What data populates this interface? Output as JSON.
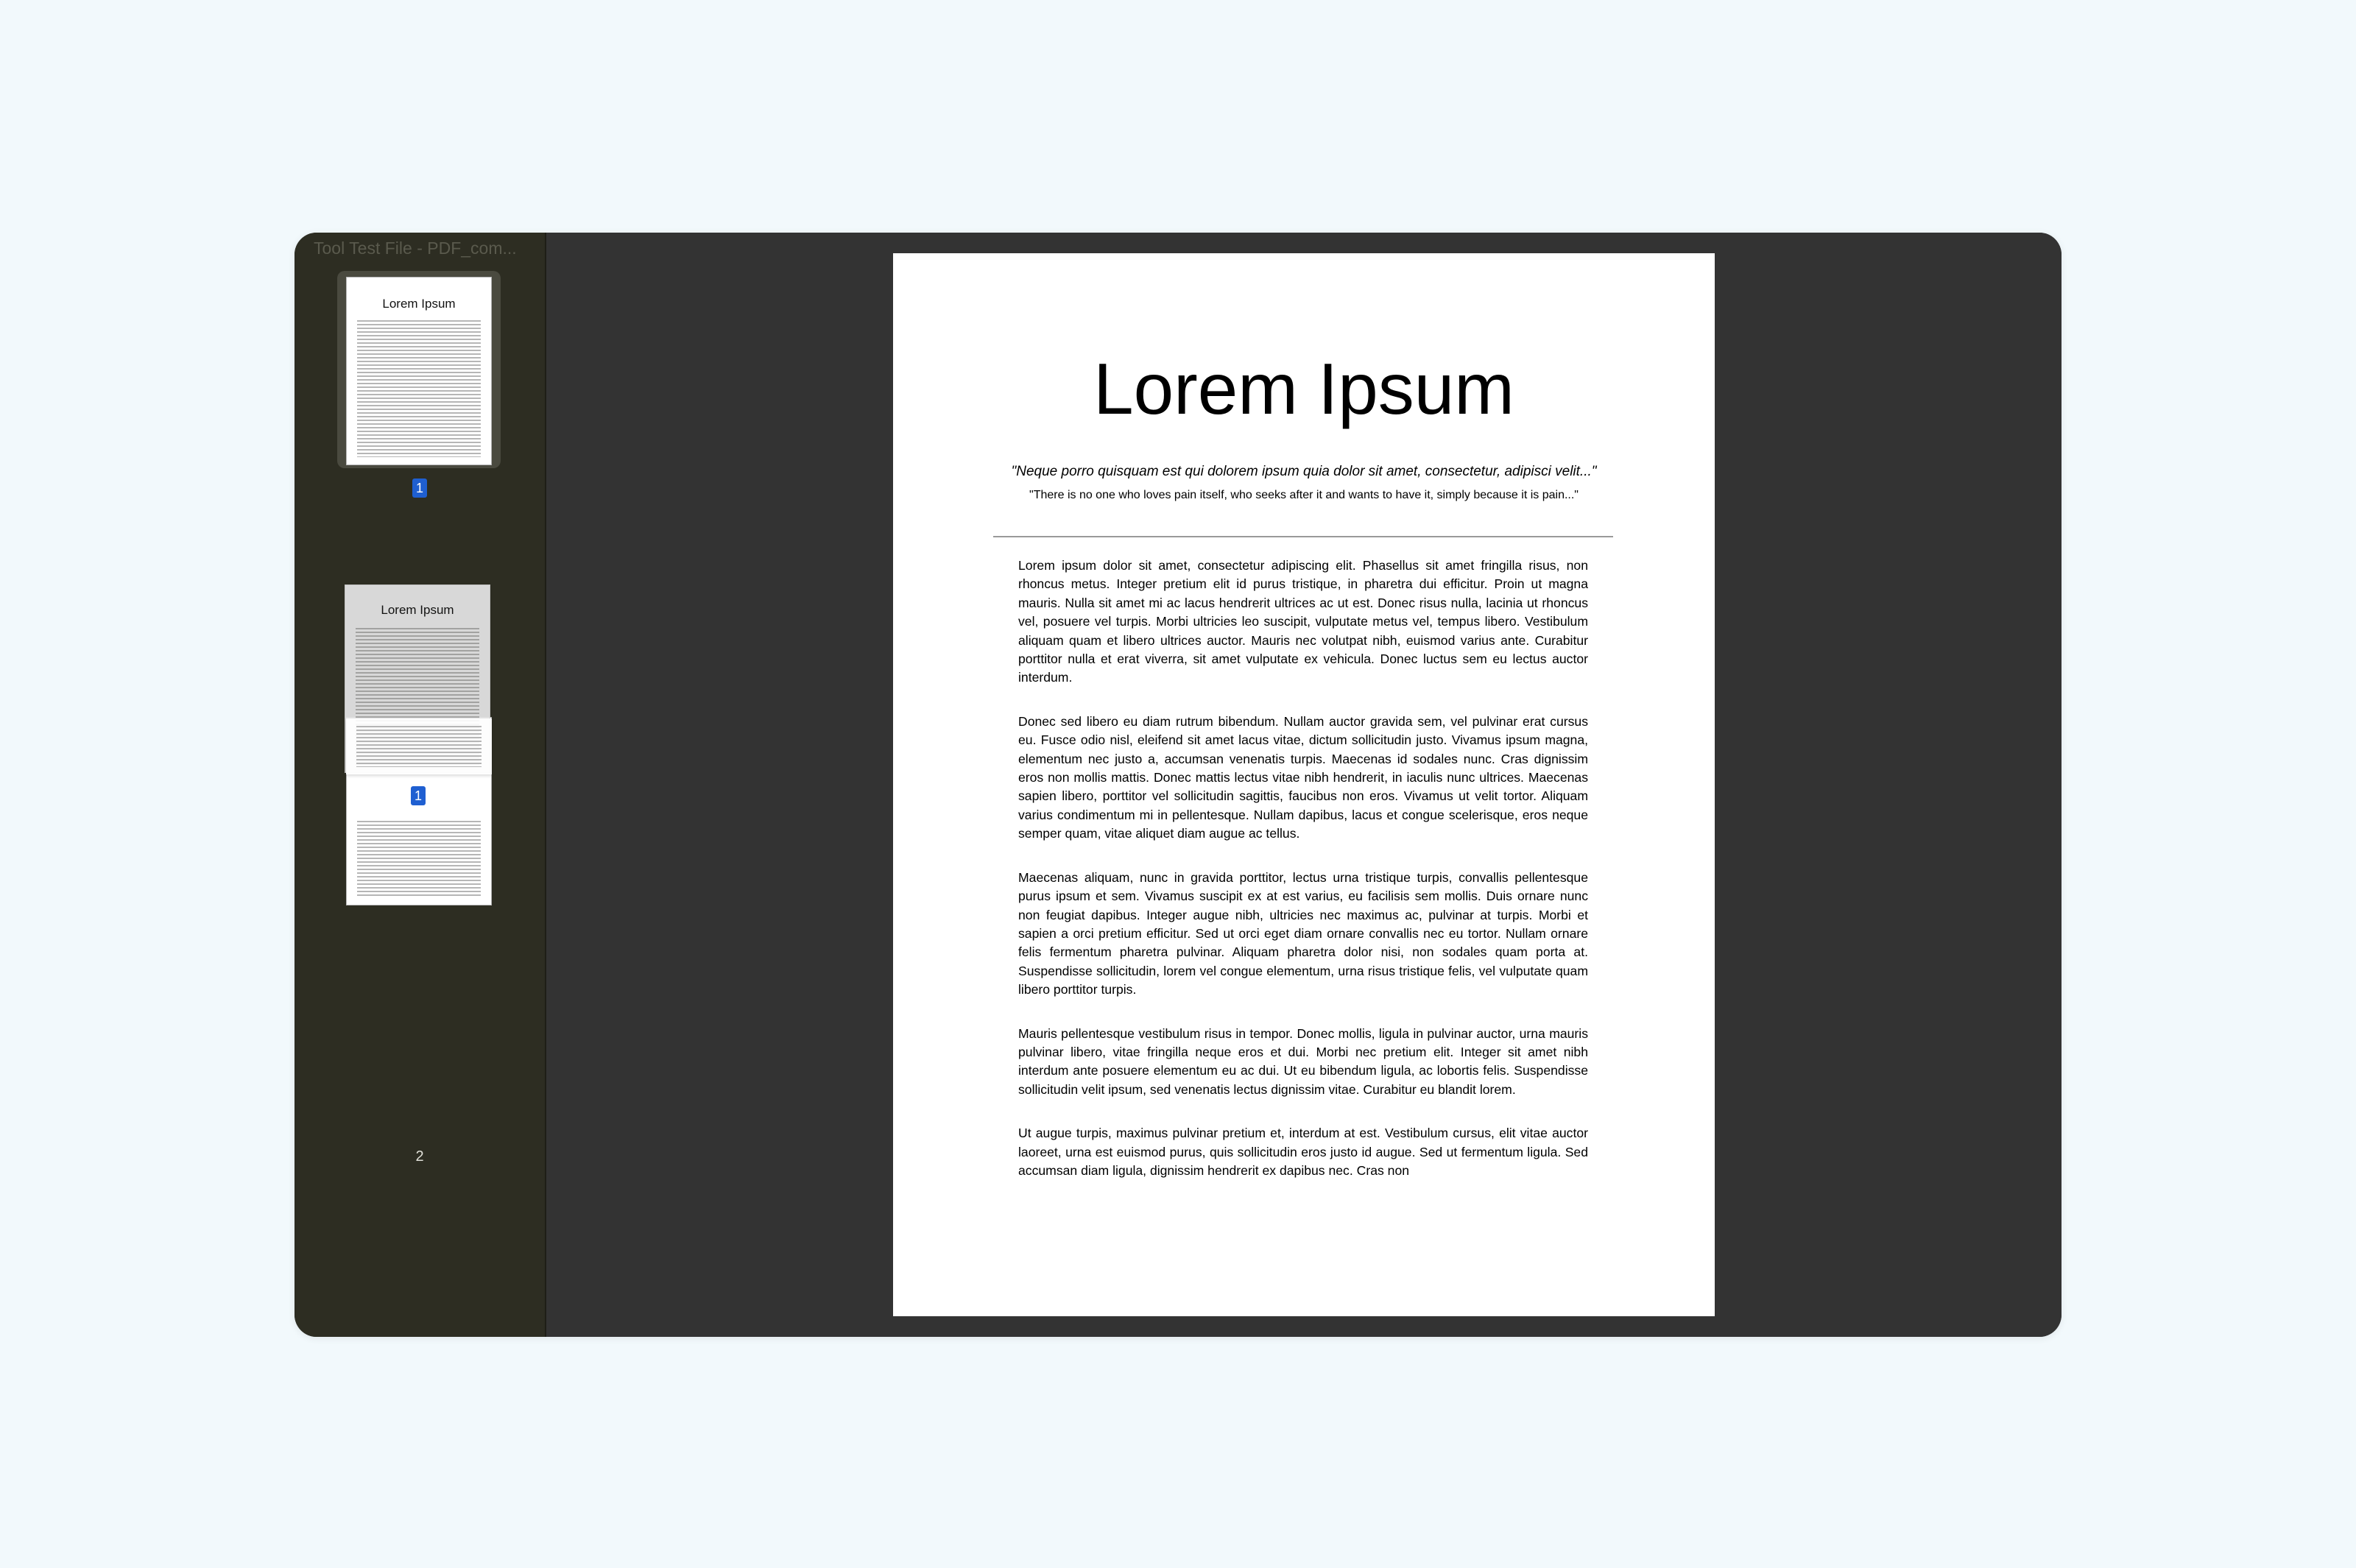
{
  "window": {
    "title": "Tool Test File - PDF_com..."
  },
  "sidebar": {
    "thumbnails": [
      {
        "title": "Lorem Ipsum",
        "badge": "1"
      },
      {
        "title": "Lorem Ipsum",
        "badge": "1",
        "label": "2"
      }
    ],
    "dragging_title": "Lorem Ipsum"
  },
  "document": {
    "title": "Lorem Ipsum",
    "quote_italic": "\"Neque porro quisquam est qui dolorem ipsum quia dolor sit amet, consectetur, adipisci velit...\"",
    "quote_plain": "\"There is no one who loves pain itself, who seeks after it and wants to have it, simply because it is pain...\"",
    "paragraphs": [
      "Lorem ipsum dolor sit amet, consectetur adipiscing elit. Phasellus sit amet fringilla risus, non rhoncus metus. Integer pretium elit id purus tristique, in pharetra dui efficitur. Proin ut magna mauris. Nulla sit amet mi ac lacus hendrerit ultrices ac ut est. Donec risus nulla, lacinia ut rhoncus vel, posuere vel turpis. Morbi ultricies leo suscipit, vulputate metus vel, tempus libero. Vestibulum aliquam quam et libero ultrices auctor. Mauris nec volutpat nibh, euismod varius ante. Curabitur porttitor nulla et erat viverra, sit amet vulputate ex vehicula. Donec luctus sem eu lectus auctor interdum.",
      "Donec sed libero eu diam rutrum bibendum. Nullam auctor gravida sem, vel pulvinar erat cursus eu. Fusce odio nisl, eleifend sit amet lacus vitae, dictum sollicitudin justo. Vivamus ipsum magna, elementum nec justo a, accumsan venenatis turpis. Maecenas id sodales nunc. Cras dignissim eros non mollis mattis. Donec mattis lectus vitae nibh hendrerit, in iaculis nunc ultrices. Maecenas sapien libero, porttitor vel sollicitudin sagittis, faucibus non eros. Vivamus ut velit tortor. Aliquam varius condimentum mi in pellentesque. Nullam dapibus, lacus et congue scelerisque, eros neque semper quam, vitae aliquet diam augue ac tellus.",
      "Maecenas aliquam, nunc in gravida porttitor, lectus urna tristique turpis, convallis pellentesque purus ipsum et sem. Vivamus suscipit ex at est varius, eu facilisis sem mollis. Duis ornare nunc non feugiat dapibus. Integer augue nibh, ultricies nec maximus ac, pulvinar at turpis. Morbi et sapien a orci pretium efficitur. Sed ut orci eget diam ornare convallis nec eu tortor. Nullam ornare felis fermentum pharetra pulvinar. Aliquam pharetra dolor nisi, non sodales quam porta at. Suspendisse sollicitudin, lorem vel congue elementum, urna risus tristique felis, vel vulputate quam libero porttitor turpis.",
      "Mauris pellentesque vestibulum risus in tempor. Donec mollis, ligula in pulvinar auctor, urna mauris pulvinar libero, vitae fringilla neque eros et dui. Morbi nec pretium elit. Integer sit amet nibh interdum ante posuere elementum eu ac dui. Ut eu bibendum ligula, ac lobortis felis. Suspendisse sollicitudin velit ipsum, sed venenatis lectus dignissim vitae. Curabitur eu blandit lorem.",
      "Ut augue turpis, maximus pulvinar pretium et, interdum at est. Vestibulum cursus, elit vitae auctor laoreet, urna est euismod purus, quis sollicitudin eros justo id augue. Sed ut fermentum ligula. Sed accumsan diam ligula, dignissim hendrerit ex dapibus nec. Cras non"
    ]
  },
  "colors": {
    "page_background": "#f2f9fc",
    "sidebar": "#2d2d22",
    "viewer": "#333333",
    "badge": "#1f5fd1"
  }
}
